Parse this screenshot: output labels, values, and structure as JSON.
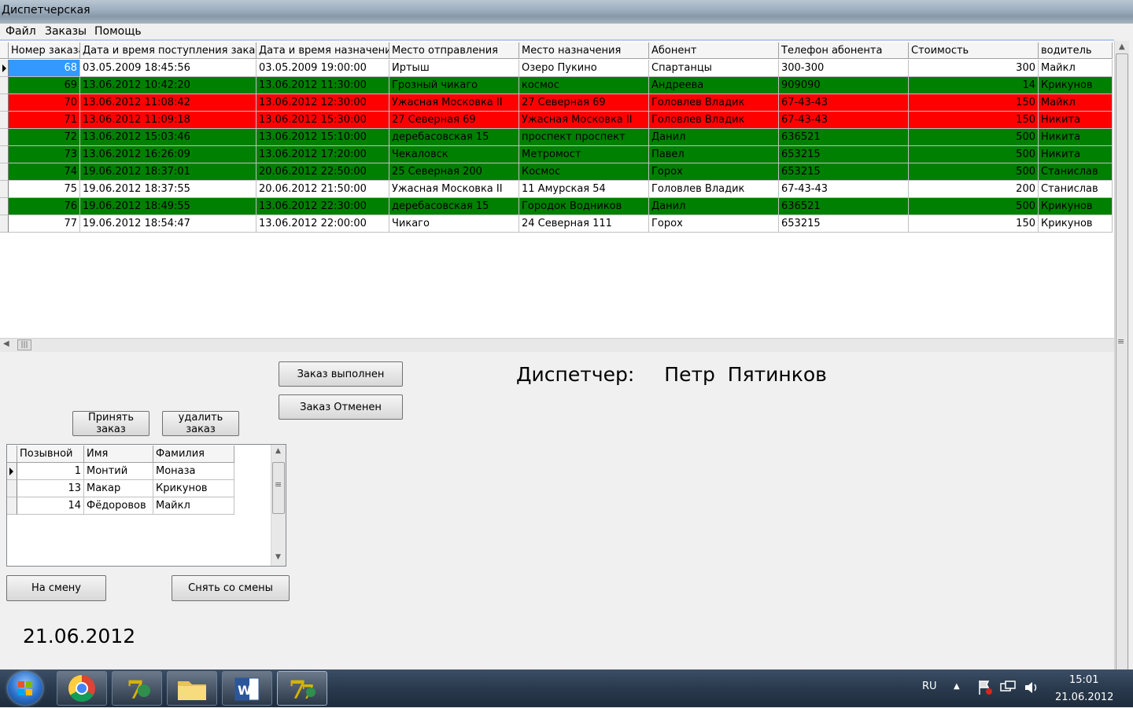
{
  "window": {
    "title": "Диспетчерская"
  },
  "menu": [
    "Файл",
    "Заказы",
    "Помощь"
  ],
  "orders": {
    "columns": [
      "Номер заказа",
      "Дата и время поступления заказа",
      "Дата и время назначения",
      "Место отправления",
      "Место назначения",
      "Абонент",
      "Телефон абонента",
      "Стоимость",
      "водитель"
    ],
    "rows": [
      {
        "status": "white",
        "cells": [
          "68",
          "03.05.2009 18:45:56",
          "03.05.2009 19:00:00",
          "Иртыш",
          "Озеро Пукино",
          "Спартанцы",
          "300-300",
          "300",
          "Майкл"
        ]
      },
      {
        "status": "green",
        "cells": [
          "69",
          "13.06.2012 10:42:20",
          "13.06.2012 11:30:00",
          "Грозный чикаго",
          "космос",
          "Андреева",
          "909090",
          "14",
          "Крикунов"
        ]
      },
      {
        "status": "red",
        "cells": [
          "70",
          "13.06.2012 11:08:42",
          "13.06.2012 12:30:00",
          "Ужасная Московка II",
          "27 Северная 69",
          "Головлев Владик",
          "67-43-43",
          "150",
          "Майкл"
        ]
      },
      {
        "status": "red",
        "cells": [
          "71",
          "13.06.2012 11:09:18",
          "13.06.2012 15:30:00",
          "27 Северная 69",
          "Ужасная Московка II",
          "Головлев Владик",
          "67-43-43",
          "150",
          "Никита"
        ]
      },
      {
        "status": "green",
        "cells": [
          "72",
          "13.06.2012 15:03:46",
          "13.06.2012 15:10:00",
          "деребасовская 15",
          "проспект проспект",
          "Данил",
          "636521",
          "500",
          "Никита"
        ]
      },
      {
        "status": "green",
        "cells": [
          "73",
          "13.06.2012 16:26:09",
          "13.06.2012 17:20:00",
          "Чекаловск",
          "Метромост",
          "Павел",
          "653215",
          "500",
          "Никита"
        ]
      },
      {
        "status": "green",
        "cells": [
          "74",
          "19.06.2012 18:37:01",
          "20.06.2012 22:50:00",
          "25 Северная 200",
          "Космос",
          "Горох",
          "653215",
          "500",
          "Станислав"
        ]
      },
      {
        "status": "white",
        "cells": [
          "75",
          "19.06.2012 18:37:55",
          "20.06.2012 21:50:00",
          "Ужасная Московка II",
          "11 Амурская 54",
          "Головлев Владик",
          "67-43-43",
          "200",
          "Станислав"
        ]
      },
      {
        "status": "green",
        "cells": [
          "76",
          "19.06.2012 18:49:55",
          "13.06.2012 22:30:00",
          "деребасовская 15",
          "Городок Водников",
          "Данил",
          "636521",
          "500",
          "Крикунов"
        ]
      },
      {
        "status": "white",
        "cells": [
          "77",
          "19.06.2012 18:54:47",
          "13.06.2012 22:00:00",
          "Чикаго",
          "24 Северная 111",
          "Горох",
          "653215",
          "150",
          "Крикунов"
        ]
      }
    ]
  },
  "buttons": {
    "order_done": "Заказ выполнен",
    "order_cancelled": "Заказ Отменен",
    "accept_order": "Принять заказ",
    "delete_order": "удалить заказ",
    "on_shift": "На смену",
    "off_shift": "Снять со смены"
  },
  "dispatcher": {
    "label": "Диспетчер:",
    "name": "Петр  Пятинков"
  },
  "drivers": {
    "columns": [
      "Позывной",
      "Имя",
      "Фамилия"
    ],
    "rows": [
      [
        "1",
        "Монтий",
        "Моназа"
      ],
      [
        "13",
        "Макар",
        "Крикунов"
      ],
      [
        "14",
        "Фёдоровов",
        "Майкл"
      ]
    ]
  },
  "current_date": "21.06.2012",
  "taskbar": {
    "apps": [
      "chrome-icon",
      "delphi7-icon",
      "folder-icon",
      "word-icon",
      "delphi7-icon"
    ],
    "lang": "RU",
    "time": "15:01",
    "date": "21.06.2012"
  },
  "colors": {
    "green": "#008000",
    "red": "#ff0000",
    "white": "#ffffff",
    "selection": "#3399ff"
  }
}
